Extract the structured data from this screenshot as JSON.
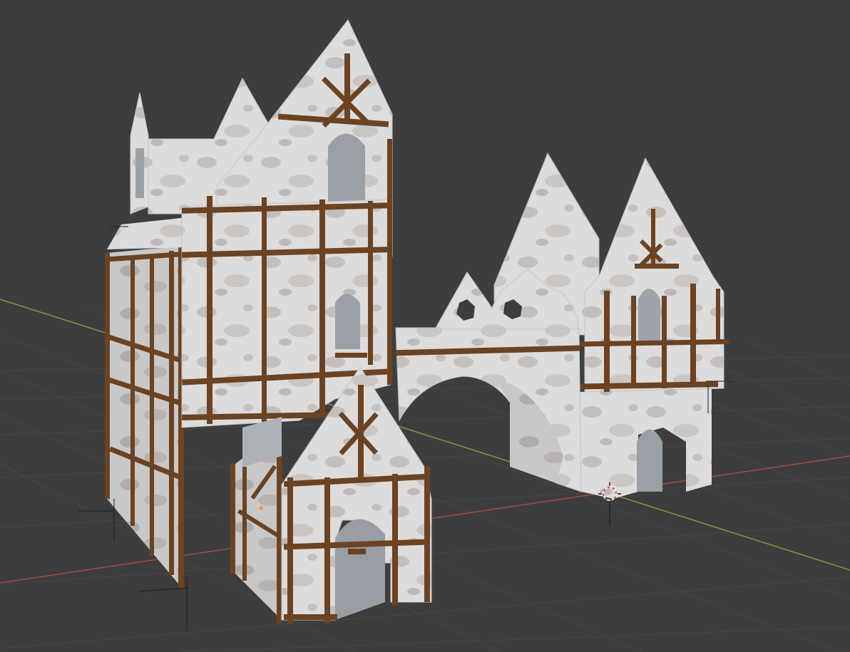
{
  "viewport": {
    "background": "#3d3d3d",
    "grid_color": "#4a4a4a",
    "axis_x_color": "#a34a4a",
    "axis_y_color": "#7d9a3a"
  },
  "scene": {
    "wall_color": "#d9d8d8",
    "wall_shade": "#bfbcbc",
    "stain_color": "#a89f9a",
    "timber_color": "#6b4322",
    "timber_dark": "#4e2f15"
  },
  "gizmos": {
    "cursor": "3d-cursor-icon",
    "origin": "object-origin-dot",
    "origin_color": "#f0a020"
  }
}
